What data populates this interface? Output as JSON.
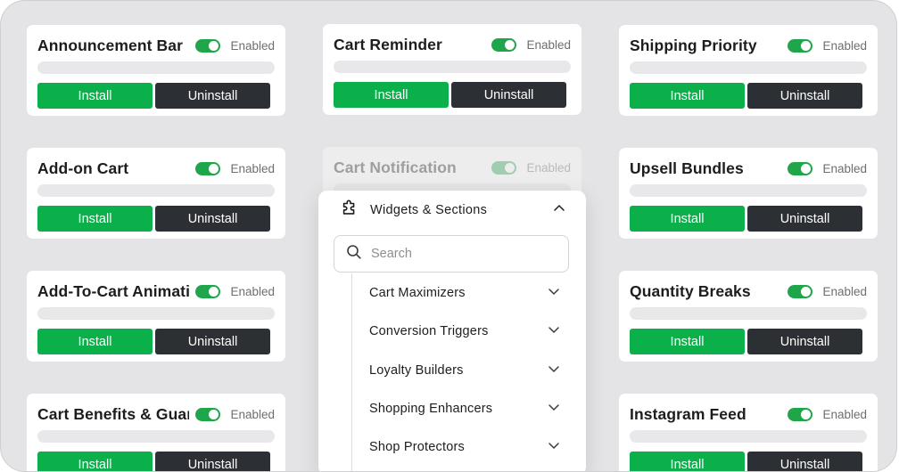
{
  "cards": [
    {
      "title": "Announcement Bar",
      "status": "Enabled",
      "install": "Install",
      "uninstall": "Uninstall"
    },
    {
      "title": "Cart Reminder",
      "status": "Enabled",
      "install": "Install",
      "uninstall": "Uninstall"
    },
    {
      "title": "Shipping Priority",
      "status": "Enabled",
      "install": "Install",
      "uninstall": "Uninstall"
    },
    {
      "title": "Add-on Cart",
      "status": "Enabled",
      "install": "Install",
      "uninstall": "Uninstall"
    },
    {
      "title": "Cart Notification",
      "status": "Enabled"
    },
    {
      "title": "Upsell Bundles",
      "status": "Enabled",
      "install": "Install",
      "uninstall": "Uninstall"
    },
    {
      "title": "Add-To-Cart Animati",
      "status": "Enabled",
      "install": "Install",
      "uninstall": "Uninstall"
    },
    {
      "title": "Quantity Breaks",
      "status": "Enabled",
      "install": "Install",
      "uninstall": "Uninstall"
    },
    {
      "title": "Cart Benefits & Guar",
      "status": "Enabled",
      "install": "Install",
      "uninstall": "Uninstall"
    },
    {
      "title": "Instagram Feed",
      "status": "Enabled",
      "install": "Install",
      "uninstall": "Uninstall"
    }
  ],
  "dropdown": {
    "title": "Widgets & Sections",
    "icon": "puzzle-icon",
    "search_placeholder": "Search",
    "items": [
      {
        "label": "Cart Maximizers"
      },
      {
        "label": "Conversion Triggers"
      },
      {
        "label": "Loyalty Builders"
      },
      {
        "label": "Shopping Enhancers"
      },
      {
        "label": "Shop Protectors"
      }
    ]
  },
  "colors": {
    "install": "#0bb04a",
    "uninstall": "#2c2f33",
    "toggle_on": "#1fa64a",
    "background": "#e4e4e6"
  }
}
